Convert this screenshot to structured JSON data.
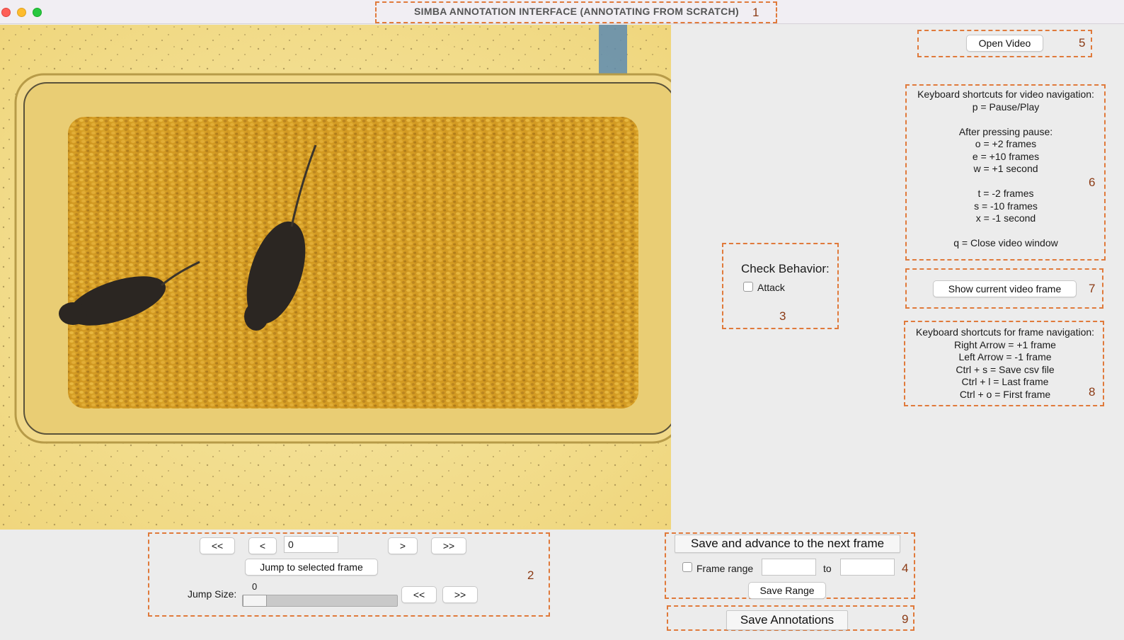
{
  "window": {
    "title": "SIMBA ANNOTATION INTERFACE (ANNOTATING FROM SCRATCH)"
  },
  "annotations": {
    "n1": "1",
    "n2": "2",
    "n3": "3",
    "n4": "4",
    "n5": "5",
    "n6": "6",
    "n7": "7",
    "n8": "8",
    "n9": "9"
  },
  "nav": {
    "first_btn": "<<",
    "prev_btn": "<",
    "frame_value": "0",
    "next_btn": ">",
    "last_btn": ">>",
    "jump_btn": "Jump to selected frame",
    "jump_size_label": "Jump Size:",
    "jump_size_value": "0",
    "slider_fraction": 0.0,
    "jump_back_btn": "<<",
    "jump_fwd_btn": ">>"
  },
  "behavior": {
    "heading": "Check Behavior:",
    "options": [
      {
        "label": "Attack",
        "checked": false
      }
    ]
  },
  "save_panel": {
    "advance_btn": "Save and advance to the next frame",
    "frame_range_label": "Frame range",
    "frame_range_checked": false,
    "range_from": "",
    "to_label": "to",
    "range_to": "",
    "save_range_btn": "Save Range"
  },
  "save_annotations_btn": "Save Annotations",
  "open_video_btn": "Open Video",
  "video_shortcuts": {
    "lines": [
      "Keyboard shortcuts for video navigation:",
      "p = Pause/Play",
      "",
      "After pressing pause:",
      "o = +2 frames",
      "e = +10 frames",
      "w = +1 second",
      "",
      "t = -2 frames",
      "s = -10 frames",
      "x = -1 second",
      "",
      "q = Close video window"
    ]
  },
  "show_frame_btn": "Show current video frame",
  "frame_shortcuts": {
    "lines": [
      "Keyboard shortcuts for frame navigation:",
      "Right Arrow = +1 frame",
      "Left Arrow = -1 frame",
      "Ctrl + s = Save csv file",
      "Ctrl + l = Last frame",
      "Ctrl + o = First frame"
    ]
  },
  "colors": {
    "annotation_dash": "#e07a3b",
    "annotation_number": "#8b3a14",
    "background": "#ececec"
  }
}
